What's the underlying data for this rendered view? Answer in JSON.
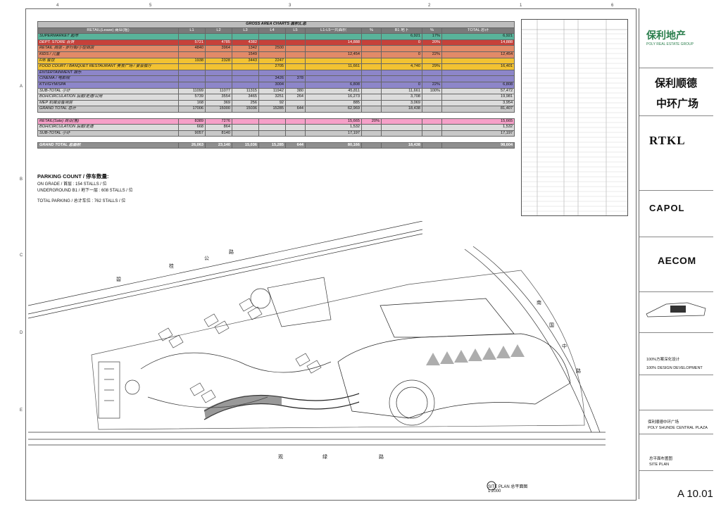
{
  "grid": {
    "top_numbers": [
      "4",
      "5",
      "3",
      "2",
      "1",
      "6"
    ],
    "left_letters": [
      "A",
      "B",
      "C",
      "D",
      "E"
    ]
  },
  "area_table": {
    "title": "GROSS AREA CHARTS 面积汇总",
    "headers": [
      "RETAIL(Lease) 商业(租)",
      "L1",
      "L2",
      "L3",
      "L4",
      "L5",
      "L1-L5一共面积",
      "%",
      "B1 地下",
      "%",
      "TOTAL 总计"
    ],
    "rows": [
      {
        "style": "super",
        "cells": [
          "SUPERMARKET 超市",
          "",
          "",
          "",
          "",
          "",
          "",
          "",
          "6,921",
          "17%",
          "6,921"
        ]
      },
      {
        "style": "dept",
        "cells": [
          "DEPT. STORE 百货",
          "5721",
          "4785",
          "4382",
          "",
          "",
          "14,888",
          "",
          "0",
          "20%",
          "14,888"
        ]
      },
      {
        "style": "retail",
        "cells": [
          "RETAIL 商店 - 步行街/小型商店",
          "4840",
          "3964",
          "1342",
          "2500",
          "",
          "",
          "",
          "",
          "",
          ""
        ]
      },
      {
        "style": "retail",
        "cells": [
          "   KIDS / 儿童",
          "",
          "",
          "1549",
          "",
          "",
          "12,454",
          "",
          "0",
          "22%",
          "12,454"
        ]
      },
      {
        "style": "fb",
        "cells": [
          "F/B 餐饮",
          "1938",
          "2328",
          "3443",
          "2247",
          "",
          "",
          "",
          "",
          "",
          ""
        ]
      },
      {
        "style": "fb",
        "cells": [
          "   FOOD COURT / BANQUET RESTAURANT 美食广场 / 宴会餐厅",
          "",
          "",
          "",
          "2705",
          "",
          "11,661",
          "",
          "4,740",
          "29%",
          "16,401"
        ]
      },
      {
        "style": "ent",
        "cells": [
          "ENTERTAINMENT 娱乐",
          "",
          "",
          "",
          "",
          "",
          "",
          "",
          "",
          "",
          ""
        ]
      },
      {
        "style": "ent",
        "cells": [
          "   CINEMA / 电影院",
          "",
          "",
          "",
          "3426",
          "378",
          "",
          "",
          "",
          "",
          ""
        ]
      },
      {
        "style": "ent",
        "cells": [
          "   KTV/GYM/SPA",
          "",
          "",
          "",
          "3004",
          "",
          "6,808",
          "",
          "0",
          "22%",
          "6,808"
        ]
      },
      {
        "style": "sub",
        "cells": [
          "SUB-TOTAL 小计",
          "11099",
          "11077",
          "11315",
          "11942",
          "380",
          "45,811",
          "",
          "11,661",
          "100%",
          "57,472"
        ]
      },
      {
        "style": "sub",
        "cells": [
          "BOH/CIRCULATION 后勤/走道/公用",
          "5739",
          "3554",
          "3465",
          "3251",
          "264",
          "16,273",
          "",
          "3,708",
          "",
          "19,981"
        ]
      },
      {
        "style": "sub",
        "cells": [
          "MEP 机械设备用房",
          "168",
          "369",
          "256",
          "92",
          "",
          "885",
          "",
          "3,069",
          "",
          "3,954"
        ]
      },
      {
        "style": "gray",
        "cells": [
          "GRAND TOTAL 总计",
          "17006",
          "15000",
          "15036",
          "15285",
          "644",
          "62,969",
          "",
          "18,438",
          "",
          "81,407"
        ]
      },
      {
        "style": "blank",
        "cells": [
          "",
          "",
          "",
          "",
          "",
          "",
          "",
          "",
          "",
          "",
          ""
        ]
      },
      {
        "style": "pink",
        "cells": [
          "RETAIL(Sale) 商业(售)",
          "8389",
          "7276",
          "",
          "",
          "",
          "15,665",
          "20%",
          "",
          "",
          "15,665"
        ]
      },
      {
        "style": "sub",
        "cells": [
          "BOH/CIRCULATION 后勤/走道",
          "668",
          "864",
          "",
          "",
          "",
          "1,532",
          "",
          "",
          "",
          "1,532"
        ]
      },
      {
        "style": "gray",
        "cells": [
          "SUB-TOTAL 小计",
          "9057",
          "8140",
          "",
          "",
          "",
          "17,197",
          "",
          "",
          "",
          "17,197"
        ]
      },
      {
        "style": "blank",
        "cells": [
          "",
          "",
          "",
          "",
          "",
          "",
          "",
          "",
          "",
          "",
          ""
        ]
      },
      {
        "style": "grand",
        "cells": [
          "GRAND TOTAL 总面积",
          "26,063",
          "23,140",
          "15,036",
          "15,285",
          "644",
          "80,166",
          "",
          "18,438",
          "",
          "98,604"
        ]
      }
    ]
  },
  "parking": {
    "title": "PARKING COUNT / 停车数量:",
    "on_grade": "ON GRADE / 首层 : 154 STALLS / 位",
    "underground": "UNDERGROUND B1 / 地下一层 : 608 STALLS / 位",
    "total": "TOTAL PARKING / 总计车位 : 762 STALLS / 位"
  },
  "title_block": {
    "poly_logo": "保利地产",
    "poly_sub": "POLY REAL ESTATE GROUP",
    "project_line1": "保利顺德",
    "project_line2": "中环广场",
    "rtkl": "RTKL",
    "capol": "CAPOL",
    "aecom": "AECOM",
    "phase_cn": "100%方案深化设计",
    "phase_en": "100% DESIGN DEVELOPMENT",
    "project_name_cn": "保利顺德中环广场",
    "project_name_en": "POLY SHUNDE CENTRAL PLAZA",
    "drawing_name_cn": "总平面布置图",
    "drawing_name_en": "SITE PLAN",
    "drawing_number": "A 10.01"
  },
  "plan": {
    "caption": "SITE PLAN 总平面图",
    "scale": "1:2000",
    "labels": [
      "碧",
      "桂",
      "公",
      "路",
      "观",
      "绿",
      "路",
      "南",
      "国",
      "中",
      "路"
    ]
  }
}
